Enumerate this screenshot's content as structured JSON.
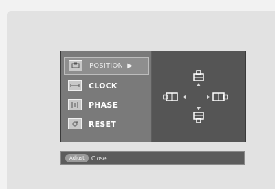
{
  "menu": {
    "items": [
      {
        "label": "POSITION",
        "icon": "position-icon",
        "selected": true
      },
      {
        "label": "CLOCK",
        "icon": "clock-icon",
        "selected": false
      },
      {
        "label": "PHASE",
        "icon": "phase-icon",
        "selected": false
      },
      {
        "label": "RESET",
        "icon": "reset-icon",
        "selected": false
      }
    ],
    "submenu_arrow": "▶"
  },
  "status": {
    "button_label": "Adjust",
    "action_label": "Close"
  },
  "colors": {
    "menu_bg": "#7a7a7a",
    "panel_bg": "#555555",
    "text": "#ffffff"
  }
}
